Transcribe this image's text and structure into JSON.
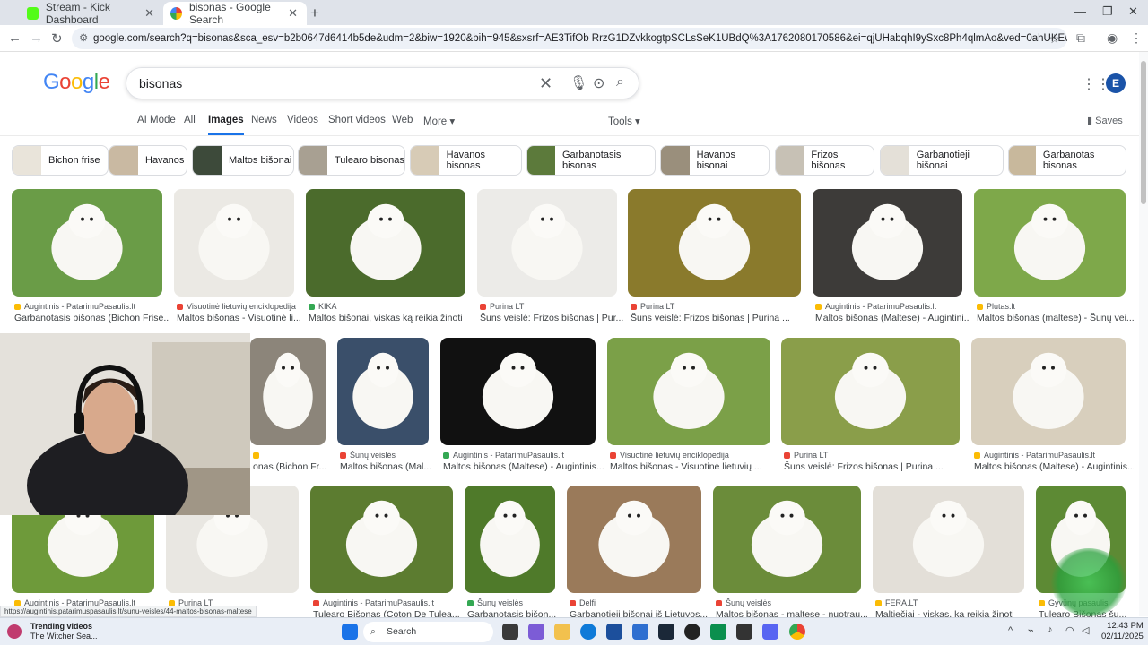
{
  "browser": {
    "tabs": [
      {
        "title": "Stream - Kick Dashboard",
        "active": false
      },
      {
        "title": "bisonas - Google Search",
        "active": true
      }
    ],
    "url": "google.com/search?q=bisonas&sca_esv=b2b0647d6414b5de&udm=2&biw=1920&bih=945&sxsrf=AE3TifOb RrzG1DZvkkogtpSCLsSeK1UBdQ%3A1762080170586&ei=qjUHabqhI9ySxc8Ph4qlmAo&ved=0ahUKEwi6noiVpNOQAxVcSfEDHQcFAqMQ4dUDCC..."
  },
  "google": {
    "query": "bisonas",
    "account_initial": "E",
    "tabs": [
      "AI Mode",
      "All",
      "Images",
      "News",
      "Videos",
      "Short videos",
      "Web",
      "More"
    ],
    "active_tab": "Images",
    "tools_label": "Tools",
    "saves_label": "Saves"
  },
  "chips": [
    "Bichon frise",
    "Havanos",
    "Maltos bišonai",
    "Tulearo bisonas",
    "Havanos bisonas",
    "Garbanotasis bisonas",
    "Havanos bisonai",
    "Frizos bišonas",
    "Garbanotieji bišonai",
    "Garbanotas bisonas"
  ],
  "results": [
    {
      "source": "Augintinis - PatarimuPasaulis.lt",
      "title": "Garbanotasis bišonas (Bichon Frise..."
    },
    {
      "source": "Visuotinė lietuvių enciklopedija",
      "title": "Maltos bišonas - Visuotinė li..."
    },
    {
      "source": "KIKA",
      "title": "Maltos bišonai, viskas ką reikia žinoti"
    },
    {
      "source": "Purina LT",
      "title": "Šuns veislė: Frizos bišonas | Pur..."
    },
    {
      "source": "Purina LT",
      "title": "Šuns veislė: Frizos bišonas | Purina ..."
    },
    {
      "source": "Augintinis - PatarimuPasaulis.lt",
      "title": "Maltos bišonas (Maltese) - Augintini..."
    },
    {
      "source": "Plutas.lt",
      "title": "Maltos bišonas (maltese) - Šunų vei..."
    },
    {
      "source": "",
      "title": "onas (Bichon Fr..."
    },
    {
      "source": "Šunų veislės",
      "title": "Maltos bišonas (Mal..."
    },
    {
      "source": "Augintinis - PatarimuPasaulis.lt",
      "title": "Maltos bišonas (Maltese) - Augintinis..."
    },
    {
      "source": "Visuotinė lietuvių enciklopedija",
      "title": "Maltos bišonas - Visuotinė lietuvių ..."
    },
    {
      "source": "Purina LT",
      "title": "Šuns veislė: Frizos bišonas | Purina ..."
    },
    {
      "source": "Augintinis - PatarimuPasaulis.lt",
      "title": "Maltos bišonas (Maltese) - Augintinis..."
    },
    {
      "source": "Augintinis - PatarimuPasaulis.lt",
      "title": ""
    },
    {
      "source": "Purina LT",
      "title": "onas |"
    },
    {
      "source": "Augintinis - PatarimuPasaulis.lt",
      "title": "Tulearo Bišonas (Coton De Tulea..."
    },
    {
      "source": "Šunų veislės",
      "title": "Garbanotasis bišon..."
    },
    {
      "source": "Delfi",
      "title": "Garbanotieji bišonai iš Lietuvos..."
    },
    {
      "source": "Šunų veislės",
      "title": "Maltos bišonas - maltese - nuotrau..."
    },
    {
      "source": "FERA.LT",
      "title": "Maltiečiai - viskas, ką reikia žinoti"
    },
    {
      "source": "Gyvūnų pasaulis",
      "title": "Tulearo Bišonas šu..."
    }
  ],
  "status_url": "https://augintinis.patarimuspasaulis.lt/sunu-veisles/44-maltos-bisonas-maltese",
  "taskbar": {
    "trending_title": "Trending videos",
    "trending_sub": "The Witcher Sea...",
    "search_label": "Search",
    "time": "12:43 PM",
    "date": "02/11/2025"
  }
}
